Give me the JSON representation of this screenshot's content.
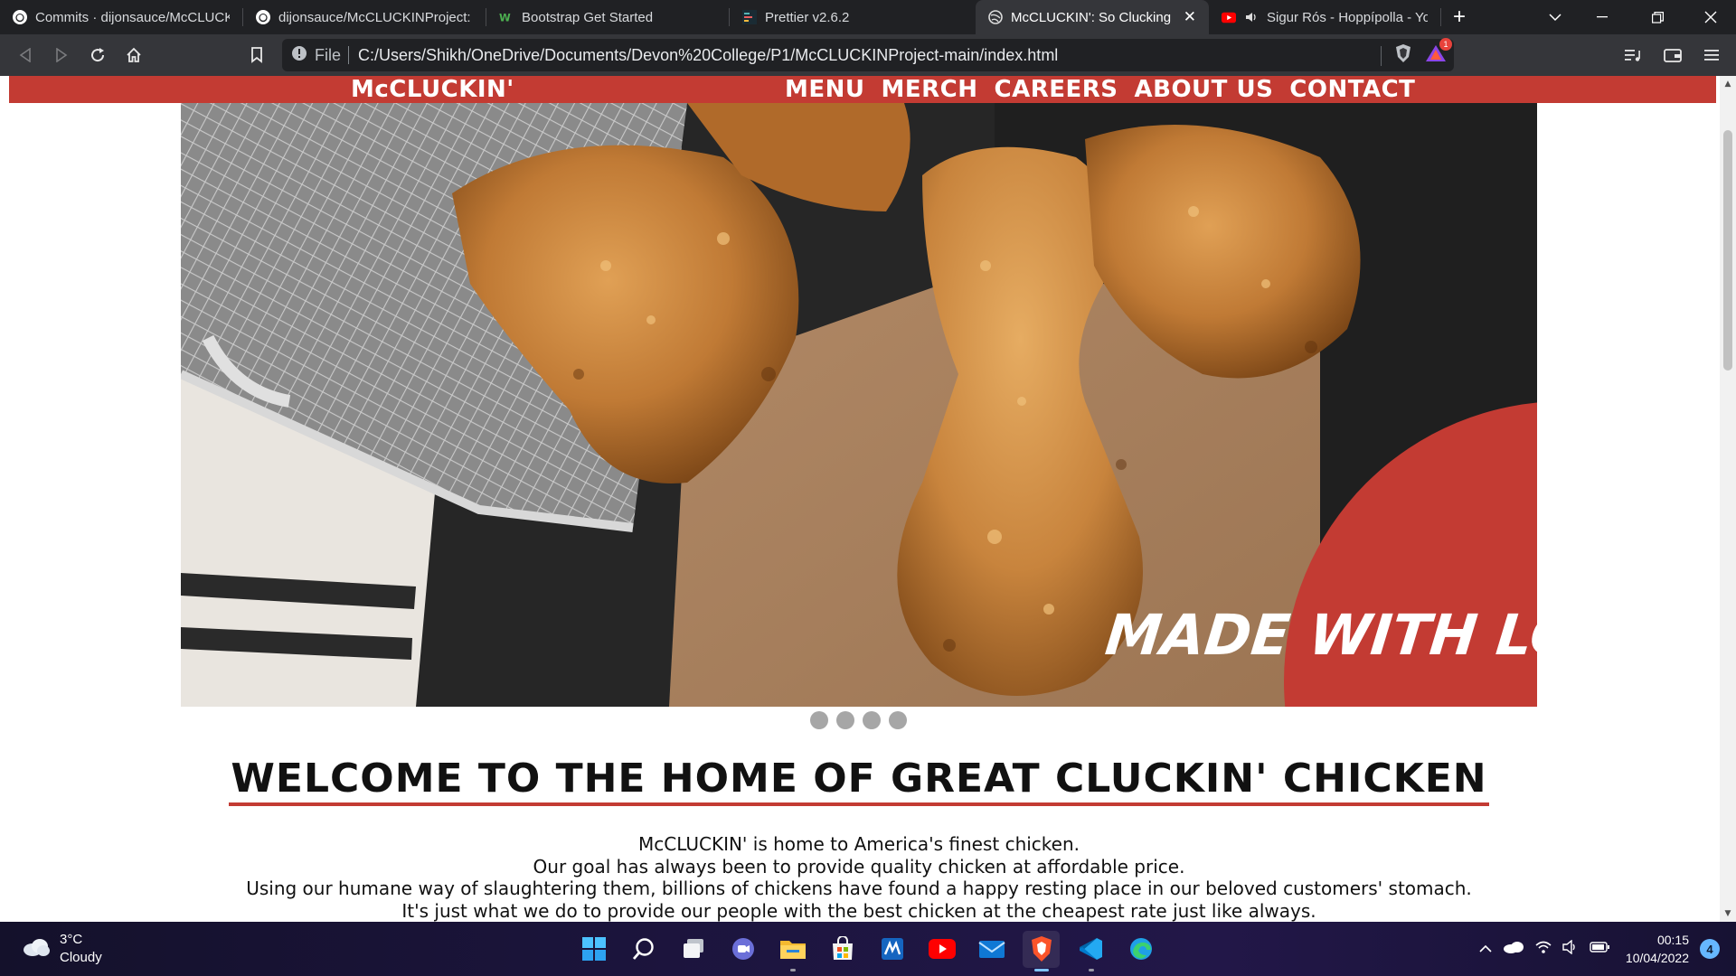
{
  "browser": {
    "tabs": [
      {
        "title": "Commits · dijonsauce/McCLUCKIN",
        "icon": "github-icon"
      },
      {
        "title": "dijonsauce/McCLUCKINProject: F",
        "icon": "github-icon"
      },
      {
        "title": "Bootstrap Get Started",
        "icon": "w3schools-icon"
      },
      {
        "title": "Prettier v2.6.2",
        "icon": "prettier-icon"
      },
      {
        "title": "McCLUCKIN': So Clucking Go",
        "icon": "globe-icon",
        "active": true
      },
      {
        "title": "Sigur Rós - Hoppípolla - YouT",
        "icon": "youtube-icon",
        "audio": true
      }
    ],
    "address": {
      "scheme_label": "File",
      "url": "C:/Users/Shikh/OneDrive/Documents/Devon%20College/P1/McCLUCKINProject-main/index.html"
    },
    "rewards_badge": "1"
  },
  "site": {
    "brand": "McCLUCKIN'",
    "nav": [
      "MENU",
      "MERCH",
      "CAREERS",
      "ABOUT US",
      "CONTACT"
    ],
    "hero_caption": "MADE WITH LOVE",
    "carousel_dots": 4,
    "heading": "WELCOME TO THE HOME OF GREAT CLUCKIN' CHICKEN",
    "intro_lines": [
      "McCLUCKIN' is home to America's finest chicken.",
      "Our goal has always been to provide quality chicken at affordable price.",
      "Using our humane way of slaughtering them, billions of chickens have found a happy resting place in our beloved customers' stomach.",
      "It's just what we do to provide our people with the best chicken at the cheapest rate just like always."
    ],
    "colors": {
      "brand_red": "#c33b33"
    }
  },
  "taskbar": {
    "weather": {
      "temp": "3°C",
      "condition": "Cloudy"
    },
    "clock": {
      "time": "00:15",
      "date": "10/04/2022"
    },
    "notifications": "4",
    "apps": [
      "windows-start-icon",
      "search-icon",
      "task-view-icon",
      "teams-chat-icon",
      "file-explorer-icon",
      "microsoft-store-icon",
      "mathcad-icon",
      "youtube-app-icon",
      "mail-icon",
      "brave-browser-icon",
      "vscode-icon",
      "edge-icon"
    ]
  }
}
